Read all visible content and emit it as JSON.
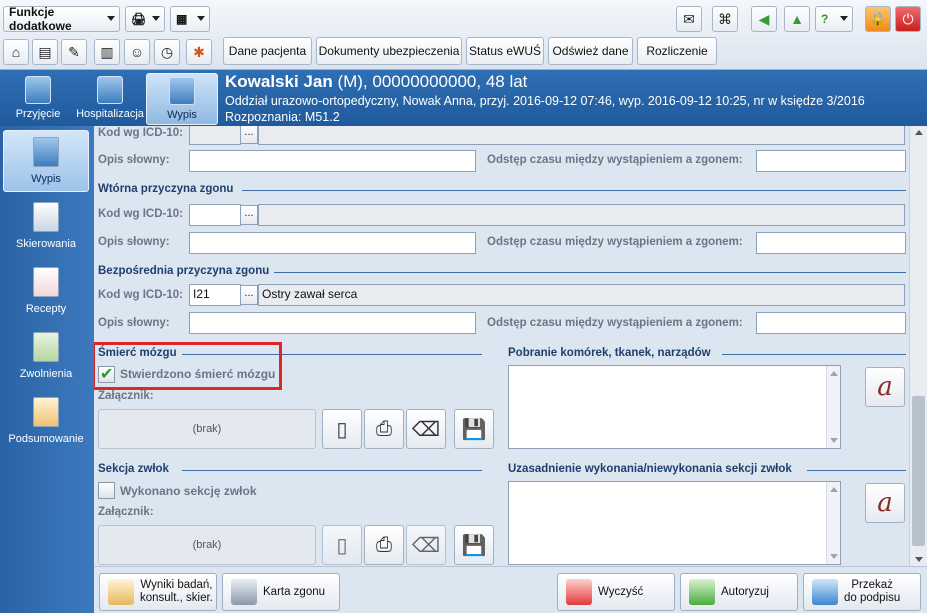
{
  "toolbar": {
    "functions_dropdown": "Funkcje dodatkowe",
    "buttons": [
      "Dane pacjenta",
      "Dokumenty ubezpieczenia",
      "Status eWUŚ",
      "Odśwież dane",
      "Rozliczenie"
    ]
  },
  "header": {
    "nav": [
      "Przyjęcie",
      "Hospitalizacja",
      "Wypis"
    ],
    "patient_name": "Kowalski Jan",
    "patient_rest": " (M), 00000000000, 48 lat",
    "line1": "Oddział urazowo-ortopedyczny, Nowak Anna, przyj. 2016-09-12 07:46, wyp. 2016-09-12 10:25, nr w księdze 3/2016",
    "line2": "Rozpoznania: M51.2"
  },
  "leftnav": [
    "Wypis",
    "Skierowania",
    "Recepty",
    "Zwolnienia",
    "Podsumowanie"
  ],
  "form": {
    "label_icd": "Kod wg ICD-10:",
    "label_desc": "Opis słowny:",
    "label_interval": "Odstęp czasu między wystąpieniem a zgonem:",
    "secondary_title": "Wtórna przyczyna zgonu",
    "direct_title": "Bezpośrednia przyczyna zgonu",
    "direct_icd_code": "I21",
    "direct_icd_desc": "Ostry zawał serca",
    "dots": "...",
    "brain_death_title": "Śmierć mózgu",
    "brain_death_checkbox": "Stwierdzono śmierć mózgu",
    "attachment_label": "Załącznik:",
    "attachment_empty": "(brak)",
    "harvest_title": "Pobranie komórek, tkanek, narządów",
    "autopsy_title": "Sekcja zwłok",
    "autopsy_checkbox": "Wykonano sekcję zwłok",
    "justification_title": "Uzasadnienie wykonania/niewykonania sekcji zwłok"
  },
  "bottom": {
    "results": "Wyniki badań,\nkonsult., skier.",
    "death_card": "Karta zgonu",
    "clear": "Wyczyść",
    "authorize": "Autoryzuj",
    "sign": "Przekaż\ndo podpisu"
  }
}
